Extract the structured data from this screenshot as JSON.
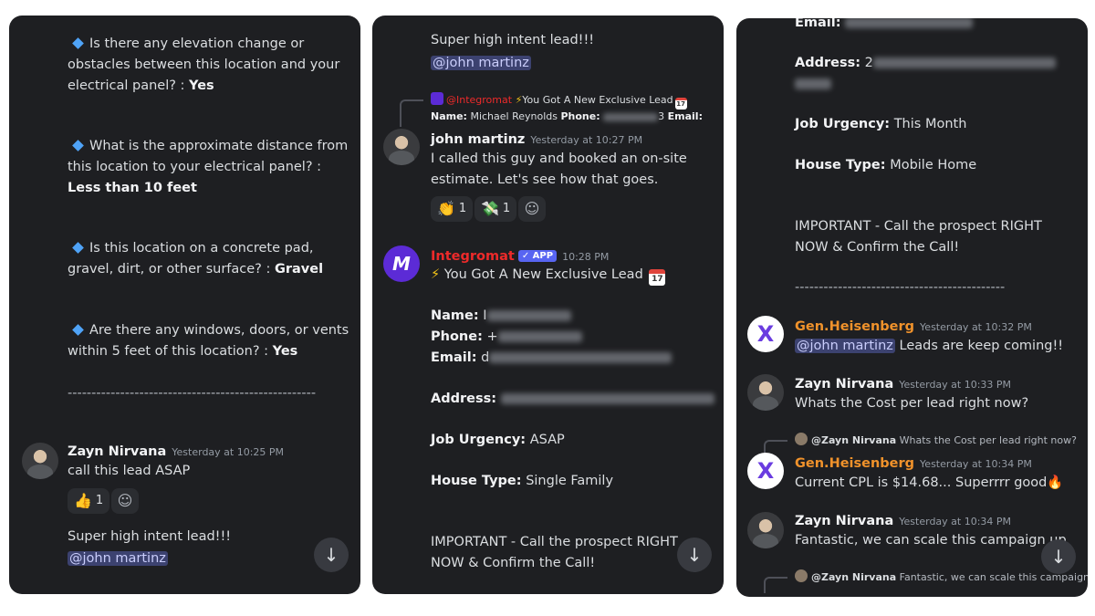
{
  "panel1": {
    "q1_text": "Is there any elevation change or obstacles between this location and your electrical panel?  :",
    "q1_answer": "Yes",
    "q2_text": "What is the approximate distance from this location to your electrical panel? :",
    "q2_answer": "Less than 10 feet",
    "q3_text": "Is this location on a concrete pad, gravel, dirt, or other surface? :",
    "q3_answer": "Gravel",
    "q4_text": "Are there any windows, doors, or vents within 5 feet of this location? :",
    "q4_answer": "Yes",
    "divider": "----------------------------------------------------",
    "msg": {
      "author": "Zayn Nirvana",
      "time": "Yesterday at 10:25 PM",
      "text": "call this lead ASAP"
    },
    "reaction1": {
      "emoji": "👍",
      "count": "1"
    },
    "followup": "Super high intent lead!!!",
    "mention": "@john martinz"
  },
  "panel2": {
    "top_text": "Super high intent lead!!!",
    "top_mention": "@john martinz",
    "reply_preview": {
      "author": "@Integromat",
      "text": "You Got A New Exclusive Lead",
      "line2_name_label": "Name:",
      "line2_name": "Michael  Reynolds",
      "line2_phone_label": "Phone:",
      "line2_phone_end": "3",
      "line2_email_label": "Email:"
    },
    "msg1": {
      "author": "john martinz",
      "time": "Yesterday at 10:27 PM",
      "text": "I called this guy and booked an on-site estimate. Let's see how that goes."
    },
    "reactions": [
      {
        "emoji": "👏",
        "count": "1"
      },
      {
        "emoji": "💸",
        "count": "1"
      }
    ],
    "msg2": {
      "author": "Integromat",
      "badge": "✓ APP",
      "time": "10:28 PM",
      "headline": "You Got A New Exclusive Lead"
    },
    "labels": {
      "name": "Name:",
      "phone": "Phone:",
      "email": "Email:",
      "address": "Address:",
      "urgency": "Job Urgency:",
      "house": "House Type:"
    },
    "values": {
      "name_start": "I",
      "phone_start": "+",
      "email_start": "d",
      "urgency": "ASAP",
      "house": "Single Family"
    },
    "important": "IMPORTANT - Call the prospect RIGHT NOW & Confirm the Call!"
  },
  "panel3": {
    "labels": {
      "email": "Email:",
      "address": "Address:",
      "urgency": "Job Urgency:",
      "house": "House Type:"
    },
    "values": {
      "address_start": "2",
      "urgency": "This Month",
      "house": "Mobile Home"
    },
    "important": "IMPORTANT - Call the prospect RIGHT NOW & Confirm the Call!",
    "divider": "--------------------------------------------",
    "msg1": {
      "author": "Gen.Heisenberg",
      "time": "Yesterday at 10:32 PM",
      "mention": "@john martinz",
      "text": "Leads are keep coming!!"
    },
    "msg2": {
      "author": "Zayn Nirvana",
      "time": "Yesterday at 10:33 PM",
      "text": "Whats the Cost per lead right now?"
    },
    "reply1": {
      "author": "@Zayn Nirvana",
      "text": "Whats the Cost per lead right now?"
    },
    "msg3": {
      "author": "Gen.Heisenberg",
      "time": "Yesterday at 10:34 PM",
      "text": "Current CPL is  $14.68... Superrrr good🔥"
    },
    "msg4": {
      "author": "Zayn Nirvana",
      "time": "Yesterday at 10:34 PM",
      "text": "Fantastic, we can scale this campaign up"
    },
    "reply2": {
      "author": "@Zayn Nirvana",
      "text": "Fantastic, we can scale this campaign"
    }
  },
  "icons": {
    "diamond": "small-blue-diamond-icon",
    "scroll": "arrow-down-icon",
    "add_reaction": "add-reaction-icon",
    "calendar": "calendar-icon",
    "bolt": "lightning-icon"
  }
}
